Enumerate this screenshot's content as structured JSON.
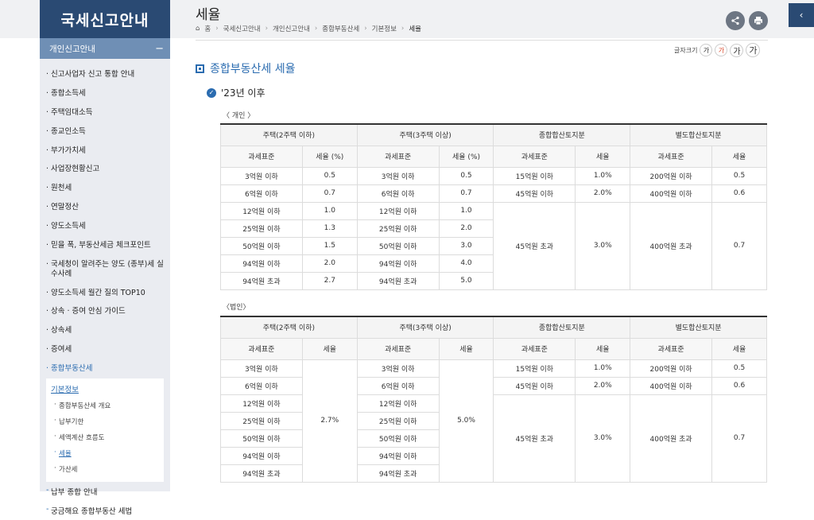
{
  "sidebar": {
    "title": "국세신고안내",
    "category": "개인신고안내",
    "items": [
      "신고사업자 신고 통합 안내",
      "종합소득세",
      "주택임대소득",
      "종교인소득",
      "부가가치세",
      "사업장현황신고",
      "원천세",
      "연말정산",
      "양도소득세",
      "믿을 폭, 부동산세금 체크포인트",
      "국세청이 알려주는 양도 (종부)세 실수사례",
      "양도소득세 월간 질의 TOP10",
      "상속 · 증여 안심 가이드",
      "상속세",
      "증여세",
      "종합부동산세"
    ],
    "submenu": {
      "head": "기본정보",
      "items": [
        "종합부동산세 개요",
        "납부기한",
        "세액계산 흐름도",
        "세율",
        "가산세"
      ]
    },
    "after": [
      "납부 종합 안내",
      "궁금해요 종합부동산 세법"
    ]
  },
  "header": {
    "title": "세율",
    "breadcrumb": [
      "홈",
      "국세신고안내",
      "개인신고안내",
      "종합부동산세",
      "기본정보",
      "세율"
    ],
    "font_size_label": "글자크기",
    "font_size_buttons": [
      "가",
      "가",
      "가",
      "가"
    ]
  },
  "content": {
    "section_title": "종합부동산세 세율",
    "subsection_title": "'23년 이후",
    "individual_caption": "〈 개인 〉",
    "corporate_caption": "〈법인〉",
    "group_headers": [
      "주택(2주택 이하)",
      "주택(3주택 이상)",
      "종합합산토지분",
      "별도합산토지분"
    ],
    "individual_sub_headers": [
      "과세표준",
      "세율 (%)",
      "과세표준",
      "세율 (%)",
      "과세표준",
      "세율",
      "과세표준",
      "세율"
    ],
    "corporate_sub_headers": [
      "과세표준",
      "세율",
      "과세표준",
      "세율",
      "과세표준",
      "세율",
      "과세표준",
      "세율"
    ],
    "individual": {
      "house2": [
        [
          "3억원 이하",
          "0.5"
        ],
        [
          "6억원 이하",
          "0.7"
        ],
        [
          "12억원 이하",
          "1.0"
        ],
        [
          "25억원 이하",
          "1.3"
        ],
        [
          "50억원 이하",
          "1.5"
        ],
        [
          "94억원 이하",
          "2.0"
        ],
        [
          "94억원 초과",
          "2.7"
        ]
      ],
      "house3": [
        [
          "3억원 이하",
          "0.5"
        ],
        [
          "6억원 이하",
          "0.7"
        ],
        [
          "12억원 이하",
          "1.0"
        ],
        [
          "25억원 이하",
          "2.0"
        ],
        [
          "50억원 이하",
          "3.0"
        ],
        [
          "94억원 이하",
          "4.0"
        ],
        [
          "94억원 초과",
          "5.0"
        ]
      ],
      "combined": [
        [
          "15억원 이하",
          "1.0%"
        ],
        [
          "45억원 이하",
          "2.0%"
        ],
        [
          "45억원 초과",
          "3.0%"
        ]
      ],
      "separate": [
        [
          "200억원 이하",
          "0.5"
        ],
        [
          "400억원 이하",
          "0.6"
        ],
        [
          "400억원 초과",
          "0.7"
        ]
      ]
    },
    "corporate": {
      "house2_bases": [
        "3억원 이하",
        "6억원 이하",
        "12억원 이하",
        "25억원 이하",
        "50억원 이하",
        "94억원 이하",
        "94억원 초과"
      ],
      "house2_rate": "2.7%",
      "house3_bases": [
        "3억원 이하",
        "6억원 이하",
        "12억원 이하",
        "25억원 이하",
        "50억원 이하",
        "94억원 이하",
        "94억원 초과"
      ],
      "house3_rate": "5.0%",
      "combined": [
        [
          "15억원 이하",
          "1.0%"
        ],
        [
          "45억원 이하",
          "2.0%"
        ],
        [
          "45억원 초과",
          "3.0%"
        ]
      ],
      "separate": [
        [
          "200억원 이하",
          "0.5"
        ],
        [
          "400억원 이하",
          "0.6"
        ],
        [
          "400억원 초과",
          "0.7"
        ]
      ]
    }
  },
  "icons": {
    "home": "home-icon",
    "share": "share-icon",
    "print": "print-icon",
    "toggle": "chevron-left-icon",
    "check": "check-circle-icon"
  }
}
